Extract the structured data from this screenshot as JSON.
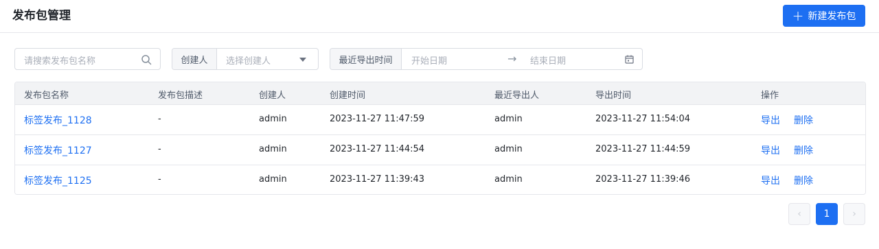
{
  "header": {
    "title": "发布包管理",
    "create_button": "新建发布包",
    "create_icon": "plus-icon"
  },
  "filters": {
    "search_placeholder": "请搜索发布包名称",
    "creator_label": "创建人",
    "creator_placeholder": "选择创建人",
    "date_label": "最近导出时间",
    "start_placeholder": "开始日期",
    "range_arrow": "→",
    "end_placeholder": "结束日期"
  },
  "table": {
    "columns": [
      "发布包名称",
      "发布包描述",
      "创建人",
      "创建时间",
      "最近导出人",
      "导出时间",
      "操作"
    ],
    "rows": [
      {
        "name": "标签发布_1128",
        "desc": "-",
        "creator": "admin",
        "created": "2023-11-27 11:47:59",
        "exporter": "admin",
        "exported": "2023-11-27 11:54:04"
      },
      {
        "name": "标签发布_1127",
        "desc": "-",
        "creator": "admin",
        "created": "2023-11-27 11:44:54",
        "exporter": "admin",
        "exported": "2023-11-27 11:44:59"
      },
      {
        "name": "标签发布_1125",
        "desc": "-",
        "creator": "admin",
        "created": "2023-11-27 11:39:43",
        "exporter": "admin",
        "exported": "2023-11-27 11:39:46"
      }
    ],
    "actions": {
      "export": "导出",
      "delete": "删除"
    }
  },
  "pagination": {
    "prev": "‹",
    "current_page": "1",
    "next": "›"
  },
  "colors": {
    "accent": "#1d6ff2",
    "header_bg": "#f2f3f5",
    "border": "#e5e6eb"
  }
}
